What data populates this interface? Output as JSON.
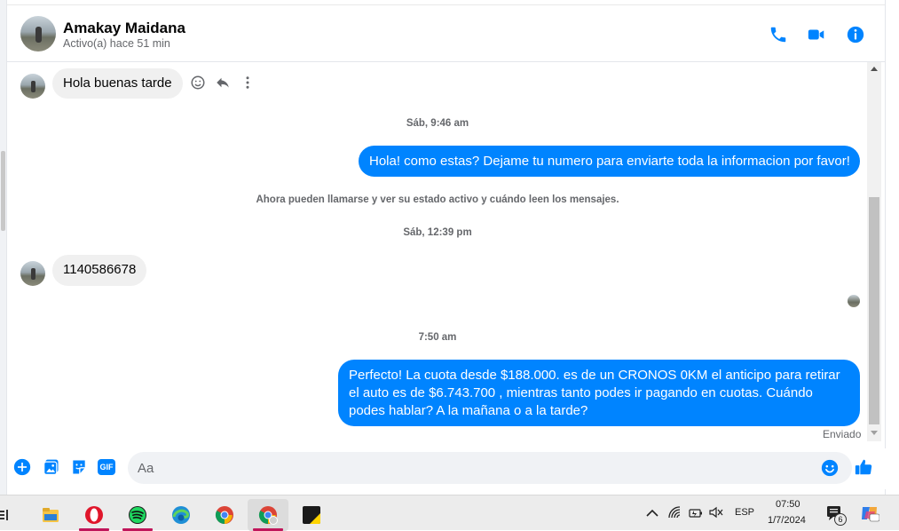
{
  "header": {
    "name": "Amakay Maidana",
    "status": "Activo(a) hace 51 min",
    "icons": [
      "phone-icon",
      "video-icon",
      "info-icon"
    ],
    "accent": "#0084ff"
  },
  "messages": {
    "m1": {
      "text": "Hola buenas tarde"
    },
    "ts1": "Sáb, 9:46 am",
    "m2": {
      "text": "Hola! como estas? Dejame tu numero para enviarte toda la informacion por favor!"
    },
    "system": "Ahora pueden llamarse y ver su estado activo y cuándo leen los mensajes.",
    "ts2": "Sáb, 12:39 pm",
    "m3": {
      "text": "1140586678"
    },
    "ts3": "7:50 am",
    "m4": {
      "text": "Perfecto! La cuota desde $188.000. es de un CRONOS 0KM el anticipo para retirar el auto es de $6.743.700 , mientras tanto podes ir pagando en cuotas. Cuándo podes hablar? A la mañana o a la tarde?"
    },
    "sent_label": "Enviado"
  },
  "composer": {
    "placeholder": "Aa",
    "icons": [
      "add-icon",
      "image-icon",
      "sticker-icon",
      "gif-icon",
      "emoji-icon",
      "like-icon"
    ],
    "gif_label": "GIF"
  },
  "taskbar": {
    "apps": [
      "taskview-icon",
      "file-explorer-icon",
      "opera-icon",
      "spotify-icon",
      "edge-icon",
      "chrome-icon",
      "chrome-profile-icon",
      "sticky-notes-icon"
    ],
    "lang": "ESP",
    "time": "07:50",
    "date": "1/7/2024",
    "notifications": "6"
  }
}
